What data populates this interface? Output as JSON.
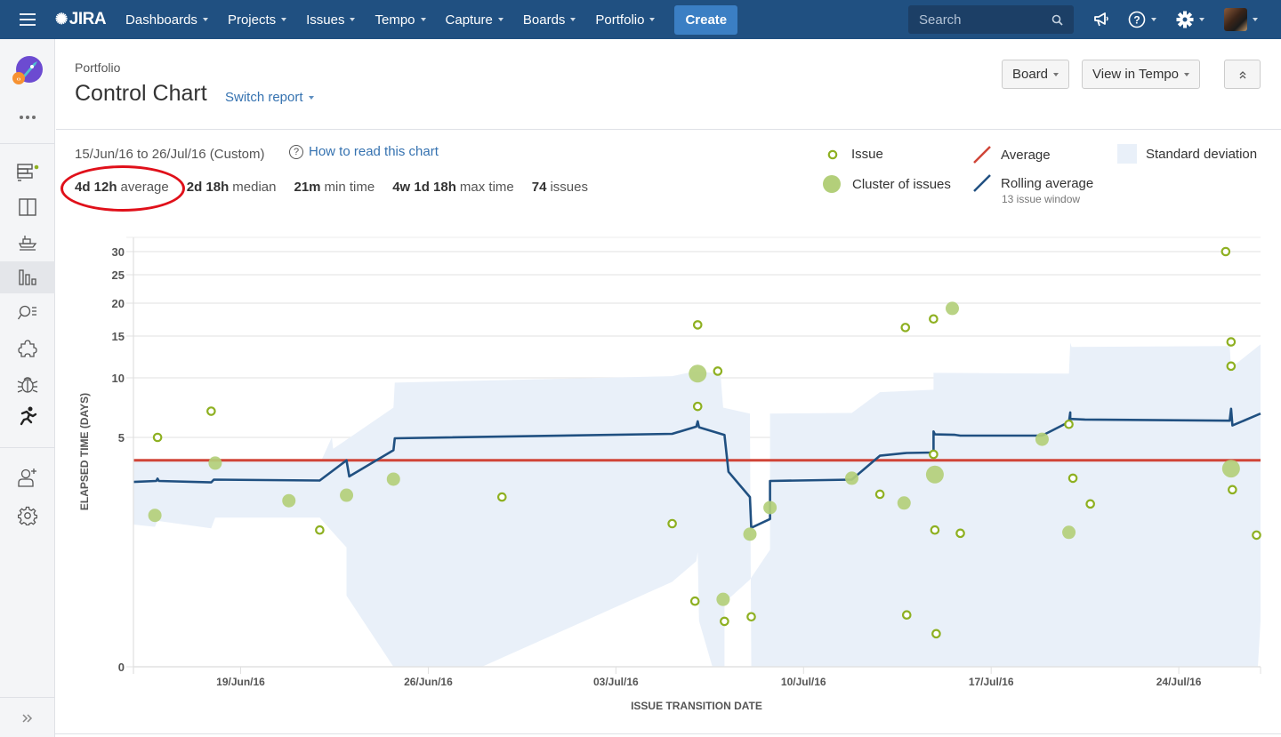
{
  "topnav": {
    "logo": "JIRA",
    "items": [
      {
        "label": "Dashboards"
      },
      {
        "label": "Projects"
      },
      {
        "label": "Issues"
      },
      {
        "label": "Tempo"
      },
      {
        "label": "Capture"
      },
      {
        "label": "Boards"
      },
      {
        "label": "Portfolio"
      }
    ],
    "create_label": "Create",
    "search_placeholder": "Search",
    "icons": [
      "megaphone-icon",
      "help-icon",
      "gear-icon",
      "avatar"
    ]
  },
  "sidebar": {
    "items": [
      {
        "name": "backlog",
        "icon": "backlog-icon",
        "active": false
      },
      {
        "name": "active-sprints",
        "icon": "board-icon",
        "active": false
      },
      {
        "name": "releases",
        "icon": "ship-icon",
        "active": false
      },
      {
        "name": "reports",
        "icon": "reports-icon",
        "active": true
      },
      {
        "name": "issues",
        "icon": "issue-search-icon",
        "active": false
      },
      {
        "name": "components",
        "icon": "puzzle-icon",
        "active": false
      },
      {
        "name": "bugs",
        "icon": "bug-icon",
        "active": false
      },
      {
        "name": "tempo",
        "icon": "runner-icon",
        "active": false
      },
      {
        "name": "add-people",
        "icon": "add-user-icon",
        "active": false
      },
      {
        "name": "settings",
        "icon": "gear-icon",
        "active": false
      }
    ],
    "expand_icon": "double-chevron-right-icon"
  },
  "header": {
    "breadcrumb": "Portfolio",
    "title": "Control Chart",
    "switch_report": "Switch report",
    "board_button": "Board",
    "tempo_button": "View in Tempo",
    "collapse_icon": "double-chevron-up-icon"
  },
  "summary": {
    "date_range": "15/Jun/16 to 26/Jul/16 (Custom)",
    "how_to": "How to read this chart",
    "stats": [
      {
        "value": "4d 12h",
        "label": "average"
      },
      {
        "value": "2d 18h",
        "label": "median"
      },
      {
        "value": "21m",
        "label": "min time"
      },
      {
        "value": "4w 1d 18h",
        "label": "max time"
      },
      {
        "value": "74",
        "label": "issues"
      }
    ]
  },
  "legend": {
    "issue": "Issue",
    "cluster": "Cluster of issues",
    "average": "Average",
    "rolling": "Rolling average",
    "rolling_sub": "13 issue window",
    "stddev": "Standard deviation"
  },
  "colors": {
    "nav_bg": "#205081",
    "issue": "#8eb021",
    "cluster": "#b3cf7a",
    "average": "#d04437",
    "rolling": "#205081",
    "stddev": "#e9f0f9",
    "annotation": "#e0101a"
  },
  "chart_data": {
    "type": "scatter",
    "title": "Control Chart",
    "xlabel": "ISSUE TRANSITION DATE",
    "ylabel": "ELAPSED TIME (DAYS)",
    "x_unit": "days since 15/Jun/16",
    "x_range": [
      0,
      42.05
    ],
    "x_ticks": [
      {
        "day": 4,
        "label": "19/Jun/16"
      },
      {
        "day": 11,
        "label": "26/Jun/16"
      },
      {
        "day": 18,
        "label": "03/Jul/16"
      },
      {
        "day": 25,
        "label": "10/Jul/16"
      },
      {
        "day": 32,
        "label": "17/Jul/16"
      },
      {
        "day": 39,
        "label": "24/Jul/16"
      }
    ],
    "y_ticks": [
      0,
      5,
      10,
      15,
      20,
      25,
      30
    ],
    "y_scale": "non-linear (compressed above 5)",
    "grid": true,
    "legend_position": "top-right",
    "average": 4.5,
    "issues": [
      {
        "x": 0.9,
        "y": 5.0
      },
      {
        "x": 2.9,
        "y": 7.2
      },
      {
        "x": 6.95,
        "y": 2.98
      },
      {
        "x": 13.75,
        "y": 3.7
      },
      {
        "x": 20.1,
        "y": 3.12
      },
      {
        "x": 21.05,
        "y": 16.7
      },
      {
        "x": 21.8,
        "y": 10.8
      },
      {
        "x": 21.05,
        "y": 7.6
      },
      {
        "x": 20.95,
        "y": 1.43
      },
      {
        "x": 22.05,
        "y": 0.99
      },
      {
        "x": 23.05,
        "y": 1.09
      },
      {
        "x": 27.85,
        "y": 3.76
      },
      {
        "x": 28.8,
        "y": 16.3
      },
      {
        "x": 29.85,
        "y": 17.6
      },
      {
        "x": 29.85,
        "y": 4.63
      },
      {
        "x": 29.9,
        "y": 2.98
      },
      {
        "x": 28.85,
        "y": 1.13
      },
      {
        "x": 29.95,
        "y": 0.72
      },
      {
        "x": 30.85,
        "y": 2.91
      },
      {
        "x": 34.9,
        "y": 6.1
      },
      {
        "x": 35.05,
        "y": 4.11
      },
      {
        "x": 35.7,
        "y": 3.55
      },
      {
        "x": 40.75,
        "y": 30.0
      },
      {
        "x": 40.95,
        "y": 14.3
      },
      {
        "x": 40.95,
        "y": 11.4
      },
      {
        "x": 41.0,
        "y": 3.86
      },
      {
        "x": 41.9,
        "y": 2.87
      }
    ],
    "clusters": [
      {
        "x": 0.8,
        "y": 3.3,
        "size": "m"
      },
      {
        "x": 3.05,
        "y": 4.44,
        "size": "m"
      },
      {
        "x": 5.8,
        "y": 3.62,
        "size": "m"
      },
      {
        "x": 7.95,
        "y": 3.74,
        "size": "m"
      },
      {
        "x": 9.7,
        "y": 4.09,
        "size": "m"
      },
      {
        "x": 21.05,
        "y": 10.5,
        "size": "l"
      },
      {
        "x": 22.0,
        "y": 1.47,
        "size": "m"
      },
      {
        "x": 23.0,
        "y": 2.89,
        "size": "m"
      },
      {
        "x": 23.75,
        "y": 3.47,
        "size": "m"
      },
      {
        "x": 26.8,
        "y": 4.11,
        "size": "m"
      },
      {
        "x": 28.75,
        "y": 3.57,
        "size": "m"
      },
      {
        "x": 30.55,
        "y": 19.2,
        "size": "m"
      },
      {
        "x": 29.9,
        "y": 4.19,
        "size": "l"
      },
      {
        "x": 33.9,
        "y": 4.96,
        "size": "m"
      },
      {
        "x": 34.9,
        "y": 2.93,
        "size": "m"
      },
      {
        "x": 40.95,
        "y": 4.32,
        "size": "l"
      }
    ],
    "rolling_average": [
      [
        0,
        4.03
      ],
      [
        0.85,
        4.05
      ],
      [
        0.9,
        4.1
      ],
      [
        0.95,
        4.05
      ],
      [
        2.9,
        4.02
      ],
      [
        3.0,
        4.08
      ],
      [
        6.95,
        4.06
      ],
      [
        7.95,
        4.5
      ],
      [
        8.05,
        4.15
      ],
      [
        9.7,
        4.72
      ],
      [
        9.75,
        4.98
      ],
      [
        20.1,
        5.3
      ],
      [
        21.0,
        5.9
      ],
      [
        21.05,
        6.35
      ],
      [
        21.1,
        5.85
      ],
      [
        22.05,
        5.2
      ],
      [
        22.2,
        4.25
      ],
      [
        23.0,
        3.7
      ],
      [
        23.05,
        3.03
      ],
      [
        23.75,
        3.22
      ],
      [
        23.75,
        4.05
      ],
      [
        26.8,
        4.08
      ],
      [
        27.85,
        4.6
      ],
      [
        28.85,
        4.66
      ],
      [
        29.85,
        4.67
      ],
      [
        29.85,
        5.5
      ],
      [
        29.9,
        5.25
      ],
      [
        30.65,
        5.22
      ],
      [
        30.85,
        5.15
      ],
      [
        33.9,
        5.15
      ],
      [
        34.9,
        6.3
      ],
      [
        34.95,
        7.1
      ],
      [
        34.95,
        6.55
      ],
      [
        35.5,
        6.5
      ],
      [
        40.9,
        6.4
      ],
      [
        40.95,
        7.4
      ],
      [
        41.0,
        6.0
      ],
      [
        42.05,
        7.0
      ]
    ],
    "std_dev_band": {
      "upper": [
        [
          0,
          4.48
        ],
        [
          7.0,
          4.48
        ],
        [
          7.4,
          5.0
        ],
        [
          7.45,
          4.75
        ],
        [
          9.7,
          7.5
        ],
        [
          9.75,
          9.6
        ],
        [
          20.1,
          10.2
        ],
        [
          21.0,
          10.8
        ],
        [
          21.9,
          10.5
        ],
        [
          22.0,
          7.5
        ],
        [
          23.0,
          7.0
        ],
        [
          23.05,
          0
        ],
        [
          23.75,
          0
        ],
        [
          23.75,
          7.0
        ],
        [
          26.8,
          7.05
        ],
        [
          27.85,
          8.8
        ],
        [
          29.85,
          9.0
        ],
        [
          29.85,
          10.6
        ],
        [
          34.9,
          10.5
        ],
        [
          34.95,
          14.2
        ],
        [
          35.0,
          13.7
        ],
        [
          40.9,
          13.8
        ],
        [
          40.95,
          11.2
        ],
        [
          42.05,
          14.0
        ]
      ],
      "lower": [
        [
          0,
          3.1
        ],
        [
          0.8,
          3.05
        ],
        [
          0.9,
          3.18
        ],
        [
          2.9,
          3.02
        ],
        [
          3.05,
          3.25
        ],
        [
          6.95,
          3.25
        ],
        [
          7.95,
          2.6
        ],
        [
          7.95,
          1.55
        ],
        [
          9.7,
          0
        ],
        [
          13.0,
          0
        ],
        [
          20.1,
          1.85
        ],
        [
          21.0,
          2.3
        ],
        [
          21.05,
          2.5
        ],
        [
          21.1,
          1.0
        ],
        [
          21.6,
          0
        ],
        [
          22.05,
          0
        ],
        [
          22.05,
          1.4
        ],
        [
          23.0,
          1.9
        ],
        [
          23.75,
          2.55
        ],
        [
          23.75,
          0
        ],
        [
          41.95,
          0
        ],
        [
          42.05,
          1.0
        ]
      ]
    }
  }
}
